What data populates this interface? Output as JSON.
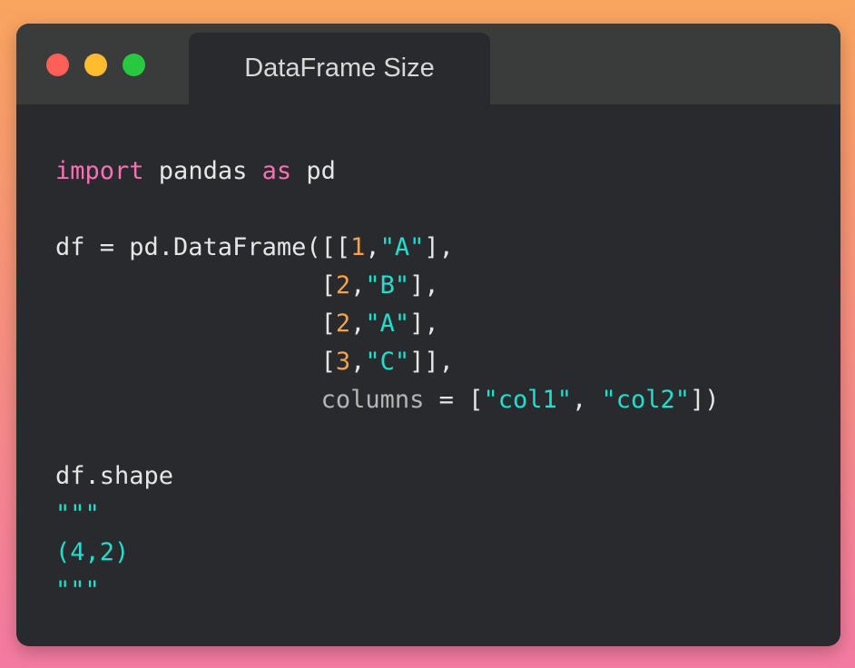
{
  "window": {
    "tab_title": "DataFrame Size",
    "controls": [
      "close",
      "minimize",
      "maximize"
    ]
  },
  "colors": {
    "keyword": "#ff6fb5",
    "number": "#f5a34a",
    "string": "#19e3d0",
    "text": "#e6e6e6",
    "param": "#b5b5b5",
    "close": "#fe5f57",
    "minimize": "#febc2e",
    "maximize": "#28c840"
  },
  "code": {
    "l1": {
      "kw1": "import",
      "t1": " pandas ",
      "kw2": "as",
      "t2": " pd"
    },
    "l3": {
      "t1": "df = pd.DataFrame([[",
      "n1": "1",
      "t2": ",",
      "s1": "\"A\"",
      "t3": "],"
    },
    "l4": {
      "t1": "                  [",
      "n1": "2",
      "t2": ",",
      "s1": "\"B\"",
      "t3": "],"
    },
    "l5": {
      "t1": "                  [",
      "n1": "2",
      "t2": ",",
      "s1": "\"A\"",
      "t3": "],"
    },
    "l6": {
      "t1": "                  [",
      "n1": "3",
      "t2": ",",
      "s1": "\"C\"",
      "t3": "]],"
    },
    "l7": {
      "t1": "                  ",
      "p1": "columns",
      "t2": " = [",
      "s1": "\"col1\"",
      "t3": ", ",
      "s2": "\"col2\"",
      "t4": "])"
    },
    "l9": {
      "t1": "df.shape"
    },
    "l10": {
      "s1": "\"\"\""
    },
    "l11": {
      "s1": "(4,2)"
    },
    "l12": {
      "s1": "\"\"\""
    }
  }
}
